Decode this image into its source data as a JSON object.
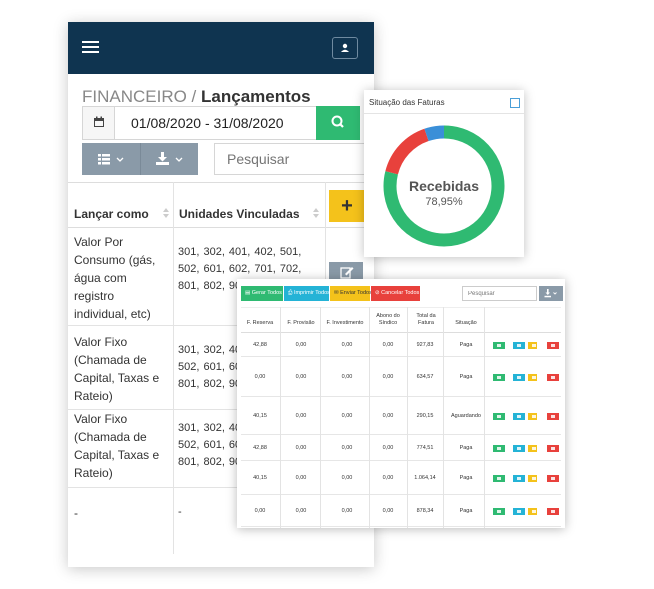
{
  "header": {
    "title_prefix": "FINANCEIRO / ",
    "title_main": "Lançamentos"
  },
  "filters": {
    "date_range": "01/08/2020 - 31/08/2020",
    "search_placeholder": "Pesquisar"
  },
  "table": {
    "columns": [
      "Lançar como",
      "Unidades Vinculadas"
    ],
    "rows": [
      {
        "type": "Valor Por Consumo (gás, água com registro individual, etc)",
        "units": "301, 302, 401, 402, 501, 502, 601, 602, 701, 702, 801, 802, 901, 902"
      },
      {
        "type": "Valor Fixo (Chamada de Capital, Taxas e Rateio)",
        "units": "301, 302, 401, 402, 501, 502, 601, 602, 701, 702, 801, 802, 901, 902"
      },
      {
        "type": "Valor Fixo (Chamada de Capital, Taxas e Rateio)",
        "units": "301, 302, 401, 402, 501, 502, 601, 602, 701, 702, 801, 802, 901, 902"
      },
      {
        "type": "-",
        "units": "-"
      }
    ]
  },
  "status_card": {
    "title": "Situação das Faturas",
    "center_label": "Recebidas",
    "center_value": "78,95%",
    "segments": [
      {
        "label": "Recebidas",
        "value": 78.95,
        "color": "#2fba72"
      },
      {
        "label": "red",
        "value": 15.8,
        "color": "#e8413c"
      },
      {
        "label": "blue",
        "value": 5.25,
        "color": "#3a8fd8"
      }
    ]
  },
  "invoices": {
    "buttons": [
      {
        "label": "Gerar Todos",
        "color": "#2fba72"
      },
      {
        "label": "Imprimir Todos",
        "color": "#24b3d6"
      },
      {
        "label": "Enviar Todos",
        "color": "#f4c21b"
      },
      {
        "label": "Cancelar Todos",
        "color": "#e8413c"
      }
    ],
    "search_placeholder": "Pesquisar",
    "headers": [
      "F. Reserva",
      "F. Provisão",
      "F. Investimento",
      "Abono do Síndico",
      "Total da Fatura",
      "Situação"
    ],
    "rows": [
      [
        "42,88",
        "0,00",
        "0,00",
        "0,00",
        "927,83",
        "Paga"
      ],
      [
        "0,00",
        "0,00",
        "0,00",
        "0,00",
        "634,57",
        "Paga"
      ],
      [
        "40,15",
        "0,00",
        "0,00",
        "0,00",
        "290,15",
        "Aguardando"
      ],
      [
        "42,88",
        "0,00",
        "0,00",
        "0,00",
        "774,51",
        "Paga"
      ],
      [
        "40,15",
        "0,00",
        "0,00",
        "0,00",
        "1.064,14",
        "Paga"
      ],
      [
        "0,00",
        "0,00",
        "0,00",
        "0,00",
        "878,34",
        "Paga"
      ]
    ]
  }
}
